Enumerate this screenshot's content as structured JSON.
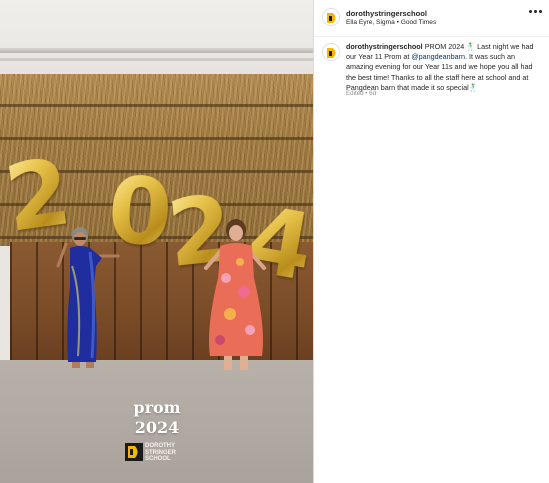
{
  "post": {
    "username": "dorothystringerschool",
    "subtitle": "Ella Eyre, Sigma • Good Times",
    "more_icon": "more-horizontal-icon"
  },
  "caption": {
    "username": "dorothystringerschool",
    "text_1": "PROM 2024 🕺 Last night we had our Year 11 Prom at ",
    "mention": "@pangdeanbarn",
    "text_2": ". It was such an amazing evening for our Year 11s and we hope you all had the best time! Thanks to all the staff here at school and at Pangdean barn that made it so special🕺",
    "meta": "Edited • 6d"
  },
  "media": {
    "balloons": [
      "2",
      "0",
      "2",
      "4"
    ],
    "watermark_line1": "prom",
    "watermark_line2": "2024",
    "logo_line1": "DOROTHY",
    "logo_line2": "STRINGER",
    "logo_line3": "SCHOOL"
  },
  "colors": {
    "username": "#262626",
    "mention": "#00376b",
    "meta": "#8e8e8e",
    "logo_yellow": "#f2b705"
  }
}
